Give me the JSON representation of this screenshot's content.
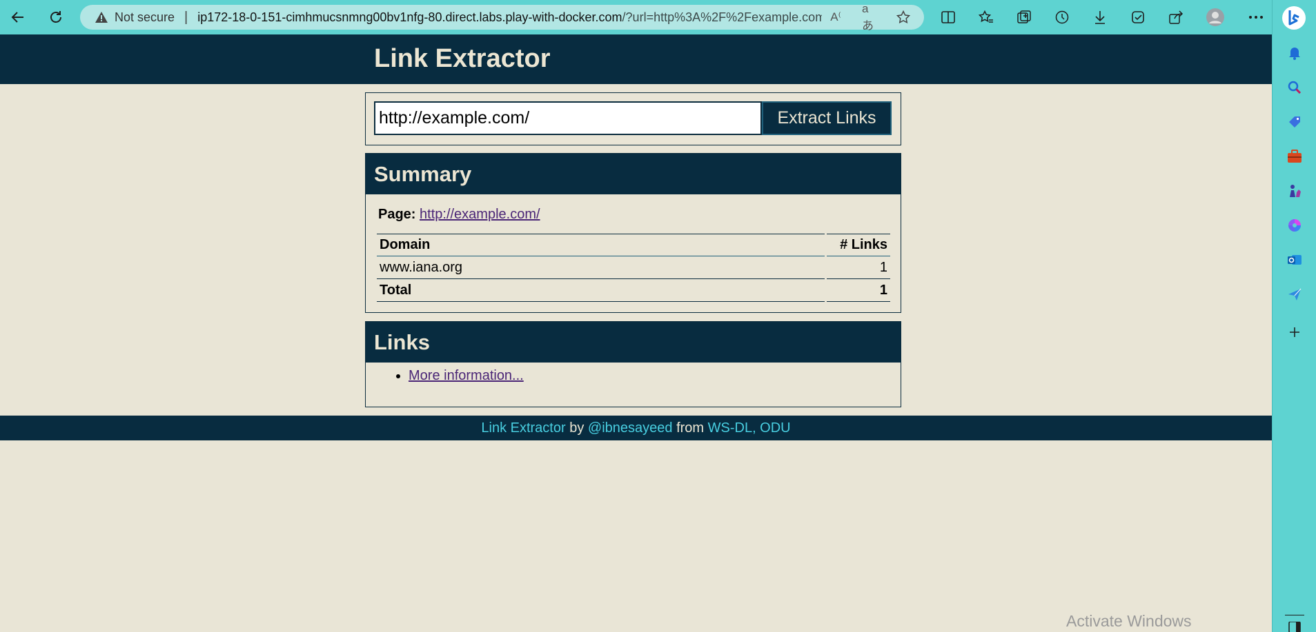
{
  "browser": {
    "security_label": "Not secure",
    "url_host": "ip172-18-0-151-cimhmucsnmng00bv1nfg-80.direct.labs.play-with-docker.com",
    "url_rest": "/?url=http%3A%2F%2Fexample.com..."
  },
  "app": {
    "title": "Link Extractor"
  },
  "form": {
    "url_value": "http://example.com/",
    "submit_label": "Extract Links"
  },
  "summary": {
    "heading": "Summary",
    "page_label": "Page:",
    "page_url": "http://example.com/",
    "columns": [
      "Domain",
      "# Links"
    ],
    "rows": [
      {
        "domain": "www.iana.org",
        "count": "1"
      }
    ],
    "total_label": "Total",
    "total_count": "1"
  },
  "links": {
    "heading": "Links",
    "items": [
      "More information..."
    ]
  },
  "footer": {
    "app_link": "Link Extractor",
    "by": "by",
    "author": "@ibnesayeed",
    "from": "from",
    "org": "WS-DL, ODU"
  },
  "os": {
    "watermark": "Activate Windows"
  }
}
